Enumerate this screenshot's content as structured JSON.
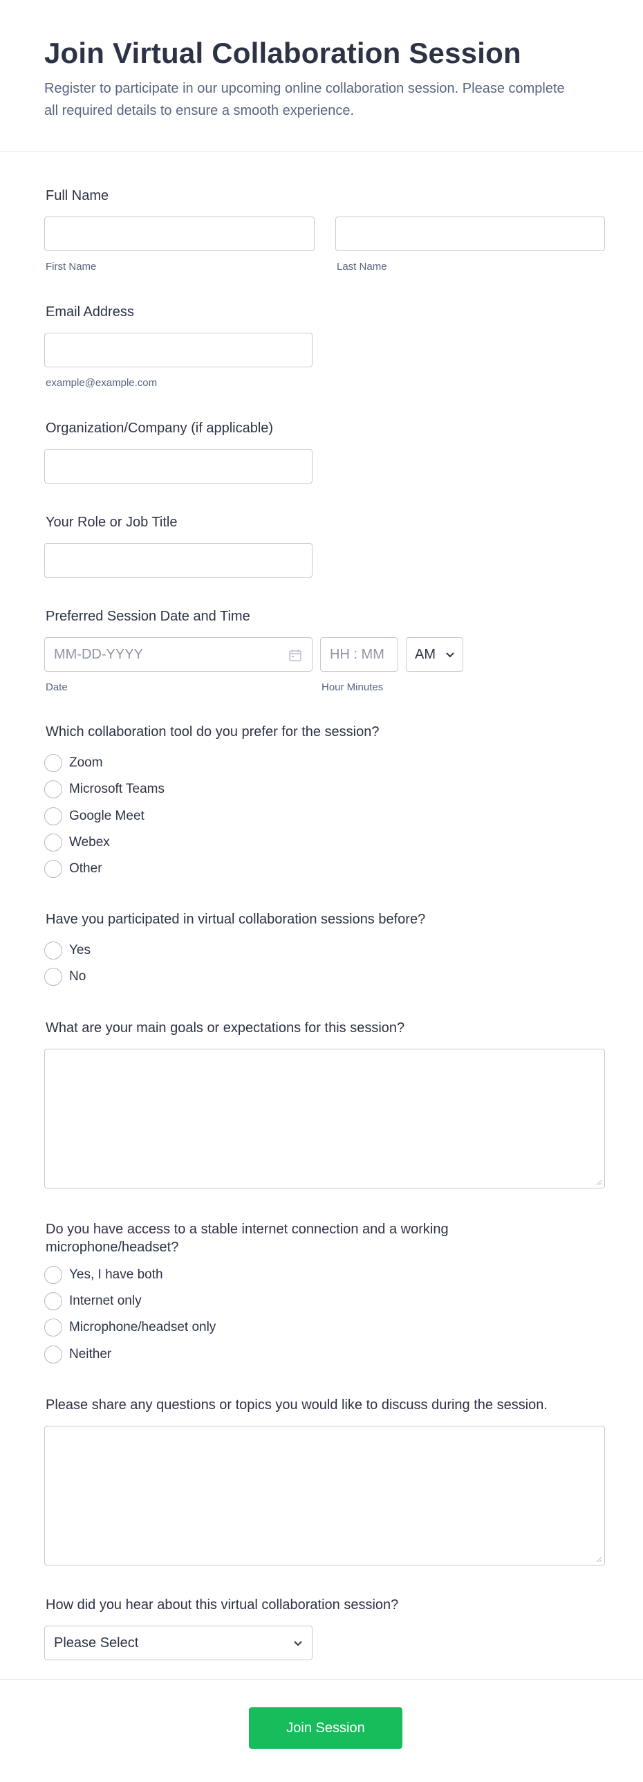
{
  "header": {
    "title": "Join Virtual Collaboration Session",
    "description": "Register to participate in our upcoming online collaboration session. Please complete all required details to ensure a smooth experience."
  },
  "full_name": {
    "label": "Full Name",
    "first_sublabel": "First Name",
    "last_sublabel": "Last Name",
    "first_value": "",
    "last_value": ""
  },
  "email": {
    "label": "Email Address",
    "sublabel": "example@example.com",
    "value": ""
  },
  "organization": {
    "label": "Organization/Company (if applicable)",
    "value": ""
  },
  "role": {
    "label": "Your Role or Job Title",
    "value": ""
  },
  "session_datetime": {
    "label": "Preferred Session Date and Time",
    "date_placeholder": "MM-DD-YYYY",
    "date_sublabel": "Date",
    "time_placeholder": "HH : MM",
    "time_sublabel": "Hour Minutes",
    "ampm_value": "AM",
    "calendar_icon": "calendar-icon"
  },
  "tool": {
    "label": "Which collaboration tool do you prefer for the session?",
    "options": [
      "Zoom",
      "Microsoft Teams",
      "Google Meet",
      "Webex",
      "Other"
    ]
  },
  "participated": {
    "label": "Have you participated in virtual collaboration sessions before?",
    "options": [
      "Yes",
      "No"
    ]
  },
  "goals": {
    "label": "What are your main goals or expectations for this session?",
    "value": ""
  },
  "connection": {
    "label_line1": "Do you have access to a stable internet connection and a working",
    "label_line2": "microphone/headset?",
    "options": [
      "Yes, I have both",
      "Internet only",
      "Microphone/headset only",
      "Neither"
    ]
  },
  "topics": {
    "label": "Please share any questions or topics you would like to discuss during the session.",
    "value": ""
  },
  "heard": {
    "label": "How did you hear about this virtual collaboration session?",
    "selected": "Please Select"
  },
  "submit": {
    "label": "Join Session"
  },
  "colors": {
    "accent": "#18bd5b",
    "text": "#2c3345",
    "muted": "#57647e",
    "border": "#c3cad8"
  }
}
